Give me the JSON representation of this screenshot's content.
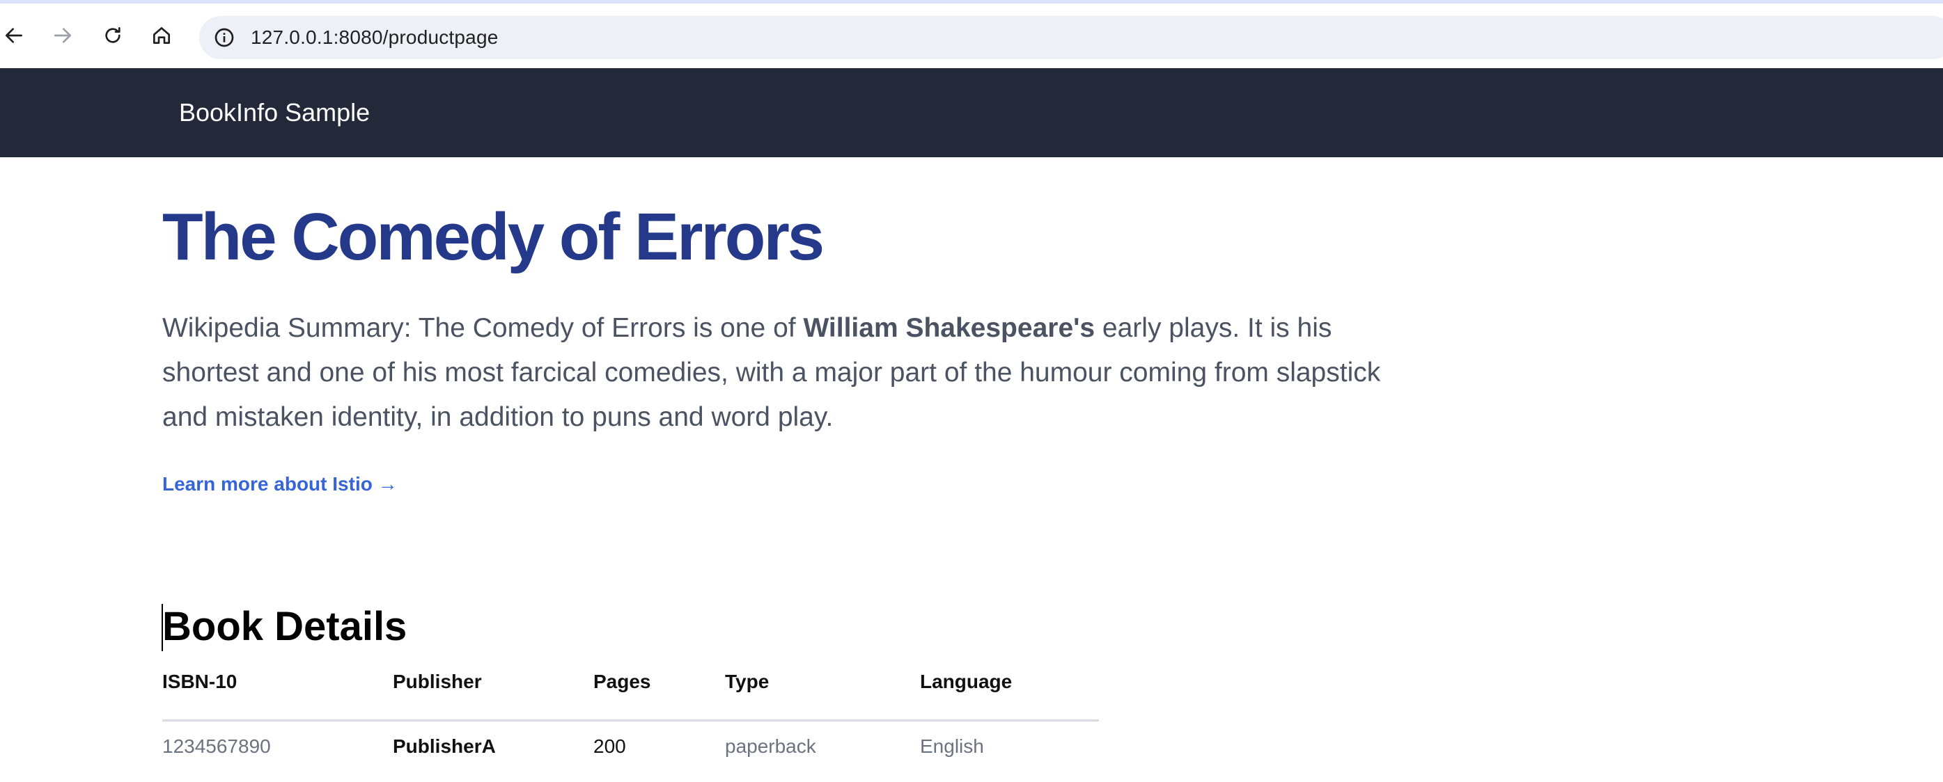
{
  "browser": {
    "url": "127.0.0.1:8080/productpage"
  },
  "navbar": {
    "brand": "BookInfo Sample"
  },
  "product": {
    "title": "The Comedy of Errors",
    "summary_prefix": "Wikipedia Summary: The Comedy of Errors is one of ",
    "summary_bold": "William Shakespeare's",
    "summary_suffix": " early plays. It is his shortest and one of his most farcical comedies, with a major part of the humour coming from slapstick and mistaken identity, in addition to puns and word play.",
    "learn_more": "Learn more about Istio →"
  },
  "details": {
    "heading": "Book Details",
    "columns": [
      "ISBN-10",
      "Publisher",
      "Pages",
      "Type",
      "Language"
    ],
    "rows": [
      [
        "1234567890",
        "PublisherA",
        "200",
        "paperback",
        "English"
      ]
    ]
  },
  "colors": {
    "navbar_bg": "#232938",
    "title": "#25398a",
    "link": "#3565d9",
    "body_text": "#4b5262"
  }
}
